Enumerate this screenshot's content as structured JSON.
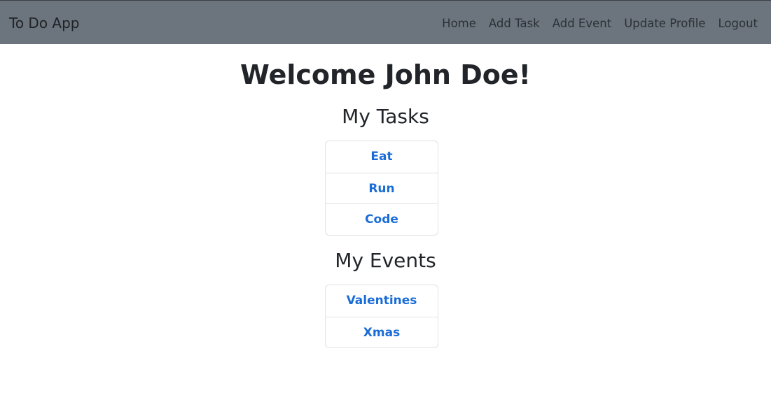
{
  "navbar": {
    "brand": "To Do App",
    "links": [
      "Home",
      "Add Task",
      "Add Event",
      "Update Profile",
      "Logout"
    ]
  },
  "main": {
    "welcome": "Welcome John Doe!",
    "tasks": {
      "title": "My Tasks",
      "items": [
        "Eat",
        "Run",
        "Code"
      ]
    },
    "events": {
      "title": "My Events",
      "items": [
        "Valentines",
        "Xmas"
      ]
    }
  },
  "colors": {
    "navbar_bg": "#6c757d",
    "link": "#1a6cd6",
    "text": "#212529",
    "border": "#dee2e6"
  }
}
